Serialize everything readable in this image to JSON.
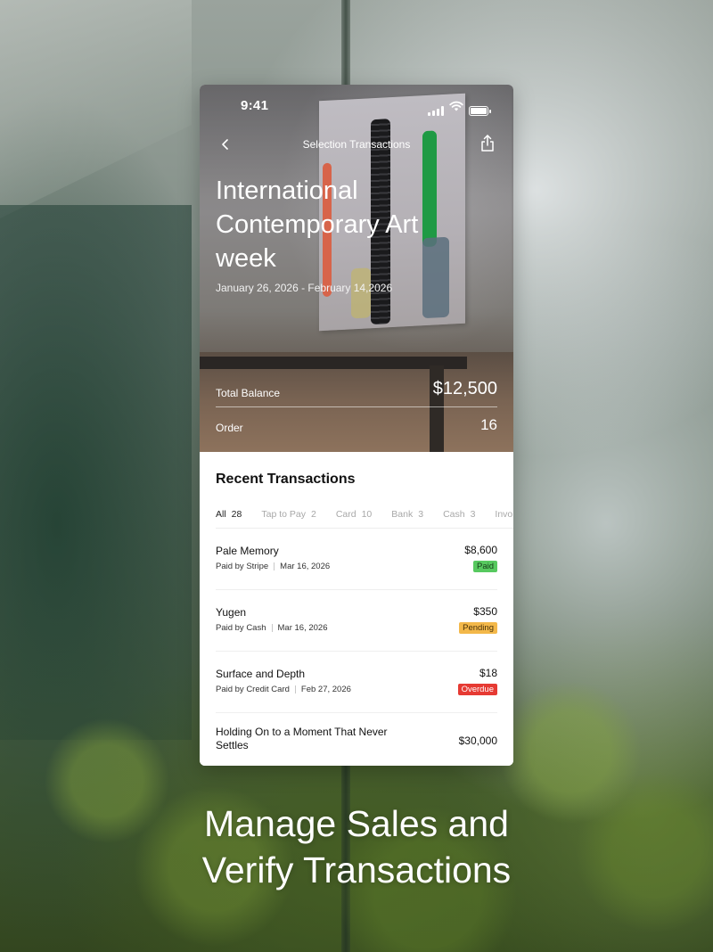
{
  "status_bar": {
    "time": "9:41",
    "icons": [
      "cellular-signal-icon",
      "wifi-icon",
      "battery-icon"
    ]
  },
  "nav": {
    "title": "Selection Transactions",
    "back_icon": "chevron-left-icon",
    "share_icon": "share-icon"
  },
  "event": {
    "title": "International Contemporary Art week",
    "dates": "January 26, 2026 - February 14,2026"
  },
  "summary": {
    "balance_label": "Total Balance",
    "balance_value": "$12,500",
    "order_label": "Order",
    "order_value": "16"
  },
  "recent": {
    "title": "Recent Transactions",
    "tabs": [
      {
        "label": "All",
        "count": "28",
        "active": true
      },
      {
        "label": "Tap to Pay",
        "count": "2"
      },
      {
        "label": "Card",
        "count": "10"
      },
      {
        "label": "Bank",
        "count": "3"
      },
      {
        "label": "Cash",
        "count": "3"
      },
      {
        "label": "Invo",
        "count": ""
      }
    ],
    "transactions": [
      {
        "name": "Pale Memory",
        "method": "Paid by Stripe",
        "date": "Mar 16, 2026",
        "amount": "$8,600",
        "status": "Paid"
      },
      {
        "name": "Yugen",
        "method": "Paid by Cash",
        "date": "Mar 16, 2026",
        "amount": "$350",
        "status": "Pending"
      },
      {
        "name": "Surface and Depth",
        "method": "Paid by Credit Card",
        "date": "Feb 27, 2026",
        "amount": "$18",
        "status": "Overdue"
      },
      {
        "name": "Holding On to a Moment That Never Settles",
        "method": "",
        "date": "",
        "amount": "$30,000",
        "status": ""
      }
    ]
  },
  "headline": {
    "line1": "Manage Sales and",
    "line2": "Verify Transactions"
  },
  "colors": {
    "paid": "#57c95f",
    "pending": "#f3b84a",
    "overdue": "#e63a33",
    "accent_text": "#111111"
  },
  "battery_level": 1.0
}
